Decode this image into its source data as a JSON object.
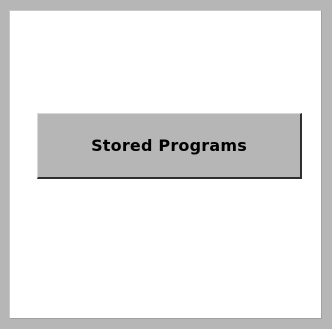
{
  "main": {
    "button_label": "Stored Programs"
  },
  "colors": {
    "frame": "#b6b6b6",
    "panel_background": "#ffffff",
    "button_face": "#b6b6b6",
    "button_shadow": "#2e2e2e"
  }
}
